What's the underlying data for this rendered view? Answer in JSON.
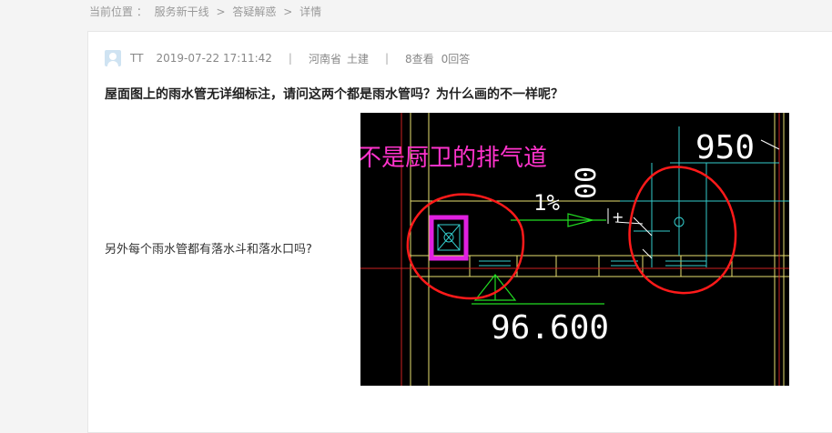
{
  "breadcrumb": {
    "label": "当前位置 ：",
    "items": [
      "服务新干线",
      "答疑解惑",
      "详情"
    ],
    "separator": ">"
  },
  "post": {
    "author": "TT",
    "datetime": "2019-07-22 17:11:42",
    "divider": "|",
    "province": "河南省",
    "discipline": "土建",
    "views": "8查看",
    "answers": "0回答",
    "title": "屋面图上的雨水管无详细标注，请问这两个都是雨水管吗？为什么画的不一样呢？",
    "body": "另外每个雨水管都有落水斗和落水口吗?"
  },
  "drawing": {
    "annotation": "这个是不是厨卫的排气道",
    "slope": "1%",
    "dim_950": "950",
    "elevation": "96.600",
    "dim_vertical": "00",
    "colors": {
      "background": "#000000",
      "annotation": "#ff33cc",
      "circle": "#ff1a1a",
      "wall": "#e8e070",
      "green": "#22dd22",
      "cyan": "#33cccc",
      "magenta": "#e020e0",
      "white": "#ffffff"
    }
  }
}
